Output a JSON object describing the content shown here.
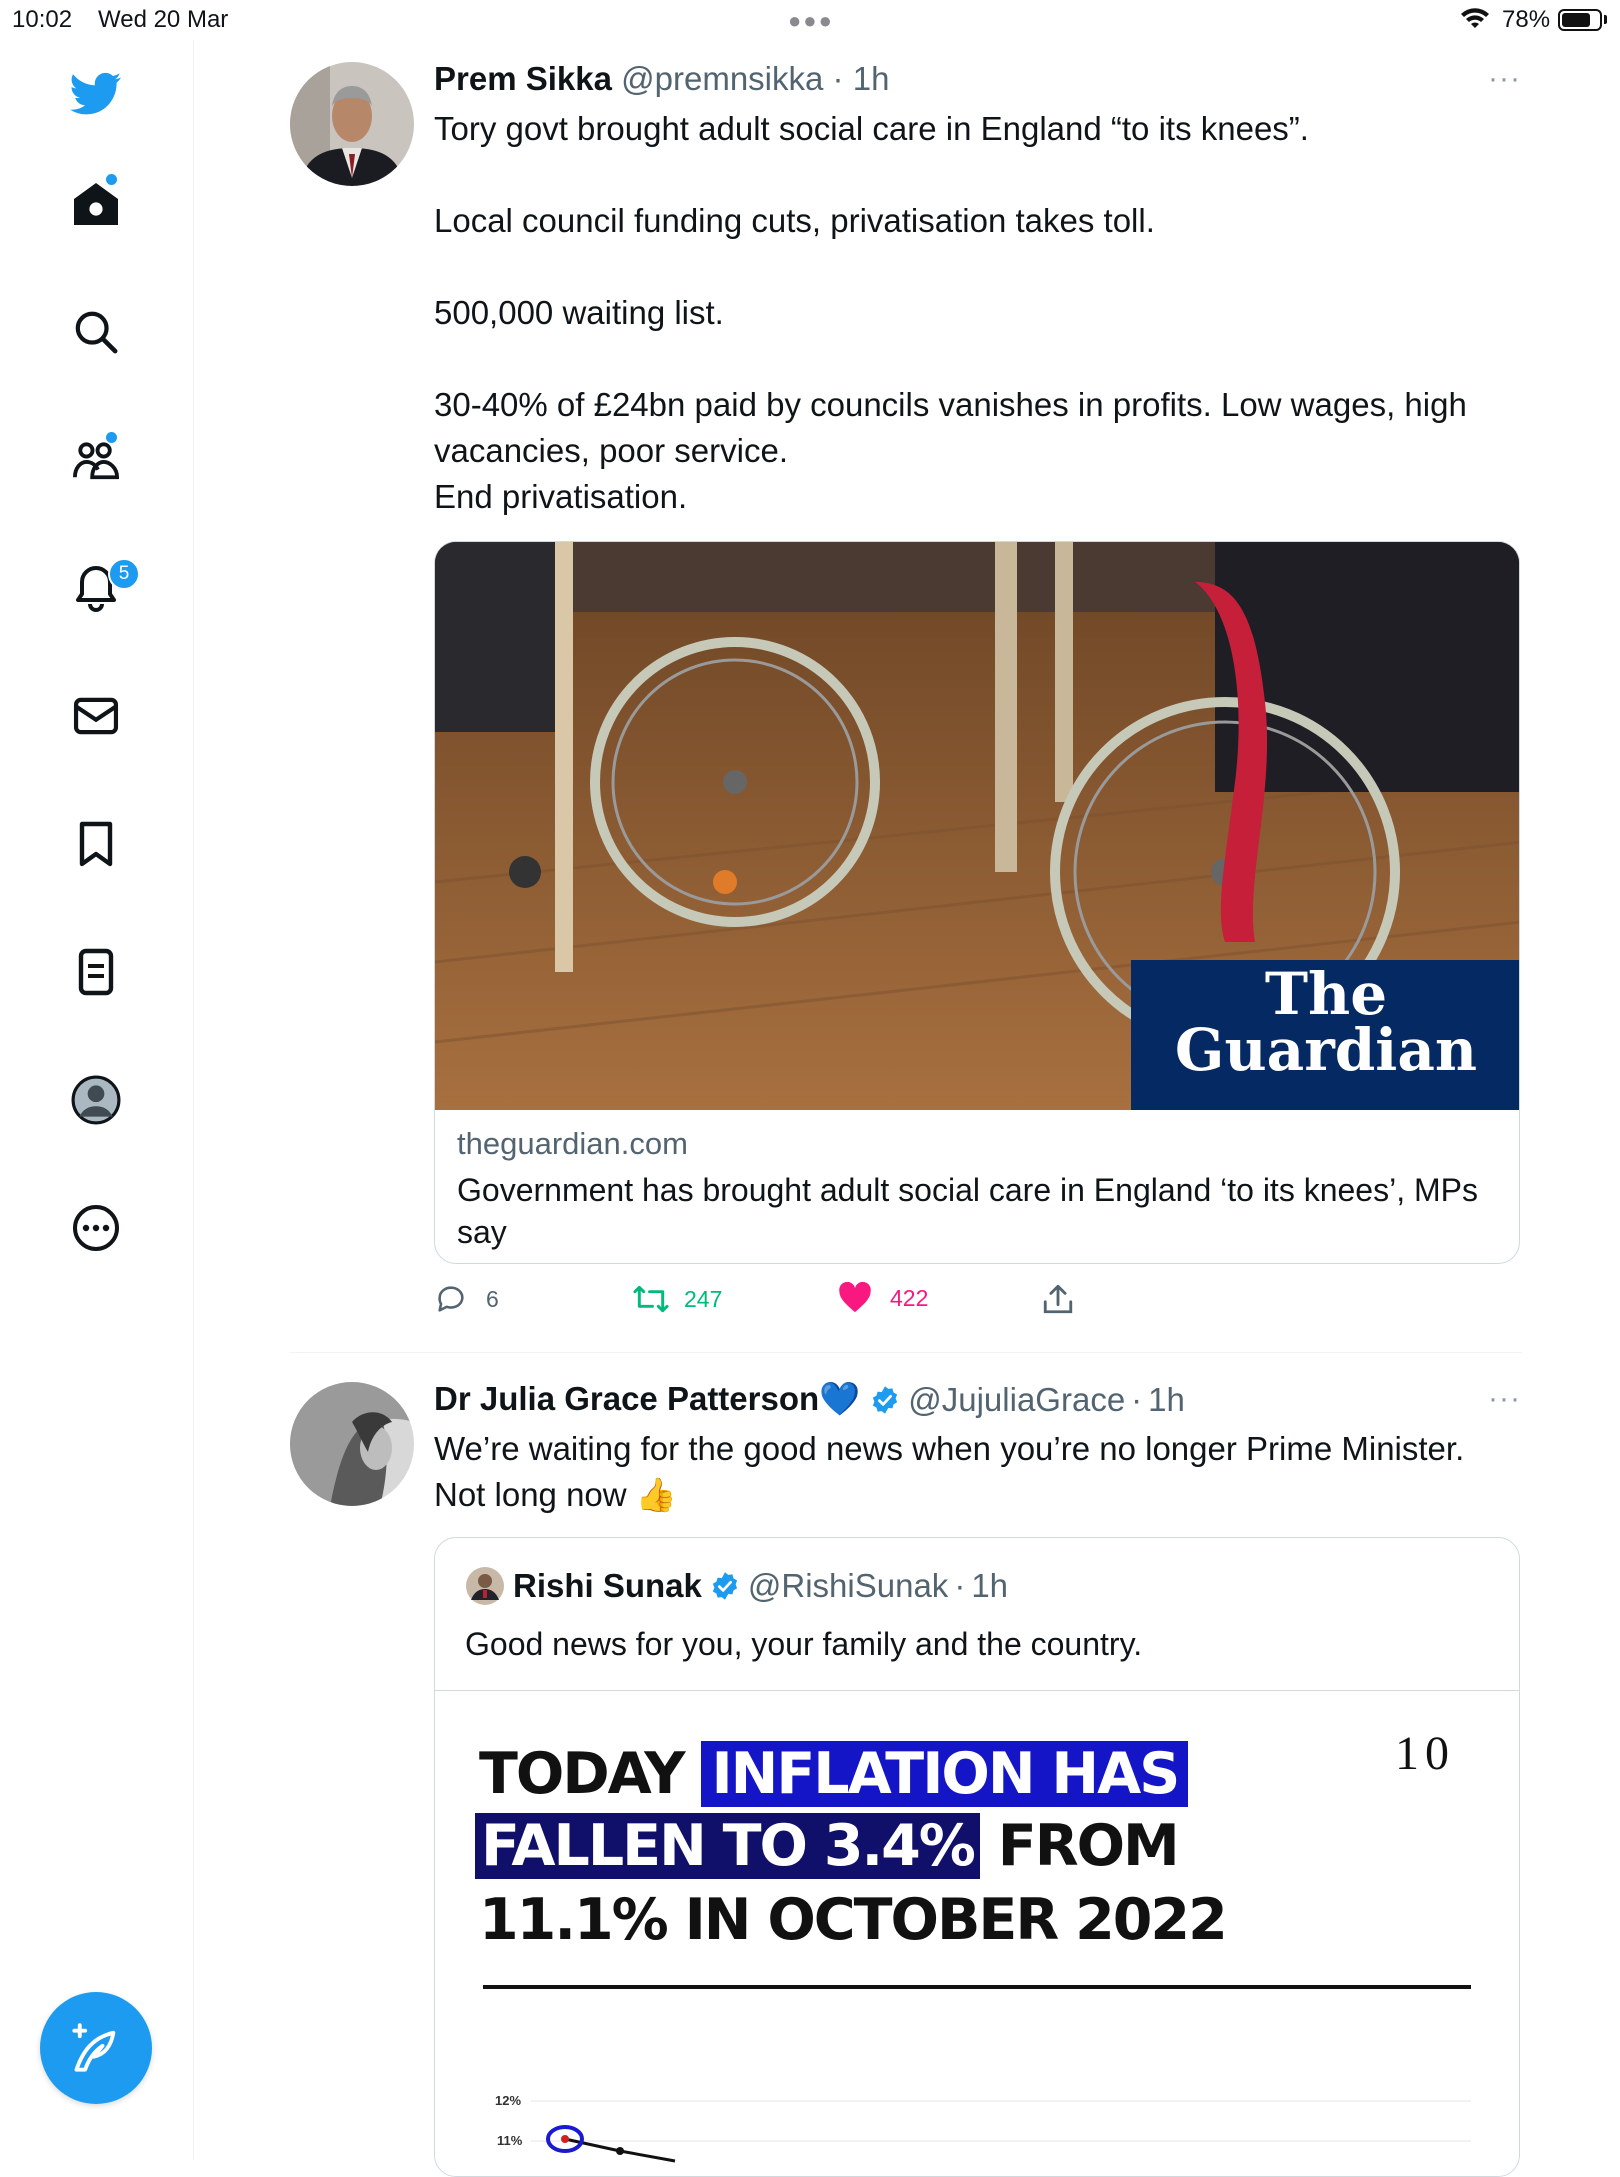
{
  "status_bar": {
    "time": "10:02",
    "date": "Wed 20 Mar",
    "battery": "78%",
    "battery_level": 0.78
  },
  "sidebar": {
    "items": [
      {
        "name": "twitter-logo-icon"
      },
      {
        "name": "home-icon"
      },
      {
        "name": "search-icon"
      },
      {
        "name": "communities-icon"
      },
      {
        "name": "notifications-icon"
      },
      {
        "name": "messages-icon"
      },
      {
        "name": "bookmarks-icon"
      },
      {
        "name": "lists-icon"
      },
      {
        "name": "profile-icon"
      },
      {
        "name": "more-icon"
      }
    ],
    "notifications_badge": "5",
    "compose_icon": "compose-feather-icon"
  },
  "tweets": [
    {
      "name": "Prem Sikka",
      "handle": "@premnsikka",
      "dot": "·",
      "time": "1h",
      "more": "···",
      "body": [
        "Tory govt brought adult social care in England “to its knees”.",
        "Local council funding cuts, privatisation takes toll.",
        "500,000 waiting list.",
        "30-40% of £24bn paid by councils vanishes in profits. Low wages, high vacancies, poor service.",
        "End privatisation."
      ],
      "card": {
        "logo_line1": "The",
        "logo_line2": "Guardian",
        "domain": "theguardian.com",
        "title": "Government has brought adult social care in England ‘to its knees’, MPs say"
      },
      "actions": {
        "replies": "6",
        "retweets": "247",
        "likes": "422"
      }
    },
    {
      "name": "Dr Julia Grace Patterson💙",
      "handle": "@JujuliaGrace",
      "dot": "·",
      "time": "1h",
      "more": "···",
      "body": [
        "We’re waiting for the good news when you’re no longer Prime Minister.",
        "Not long now 👍"
      ],
      "quote": {
        "name": "Rishi Sunak",
        "handle": "@RishiSunak",
        "dot": "·",
        "time": "1h",
        "body": "Good news for you, your family and the country.",
        "graphic": {
          "line1_a": "TODAY",
          "line1_b": "INFLATION HAS",
          "line2_a": "FALLEN TO 3.4%",
          "line2_b": "FROM",
          "line3": "11.1% IN OCTOBER 2022",
          "logo": "10",
          "y_label_top": "12%",
          "y_label_2": "11%"
        }
      }
    }
  ],
  "colors": {
    "accent": "#1d9bf0",
    "retweet": "#00ba7c",
    "like": "#f91880",
    "guardian_navy": "#052962"
  }
}
